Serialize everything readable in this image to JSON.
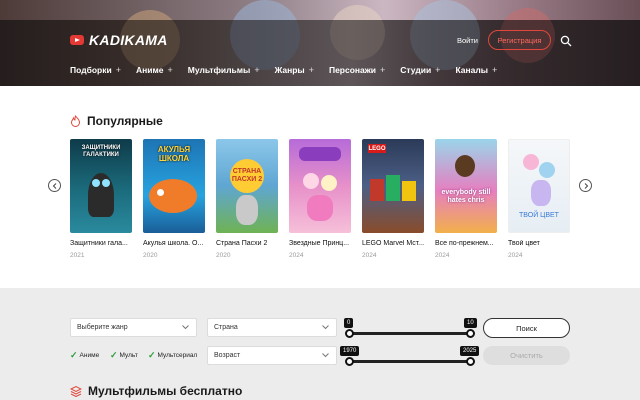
{
  "header": {
    "logo_text": "KADIKAMA",
    "login_label": "Войти",
    "register_label": "Регистрация",
    "nav": [
      {
        "label": "Подборки"
      },
      {
        "label": "Аниме"
      },
      {
        "label": "Мультфильмы"
      },
      {
        "label": "Жанры"
      },
      {
        "label": "Персонажи"
      },
      {
        "label": "Студии"
      },
      {
        "label": "Каналы"
      }
    ],
    "nav_plus": "+"
  },
  "popular": {
    "title": "Популярные",
    "cards": [
      {
        "title": "Защитники гала...",
        "year": "2021",
        "poster_text": "ЗАЩИТНИКИ ГАЛАКТИКИ",
        "bg": "#1b6c7d"
      },
      {
        "title": "Акулья школа. О...",
        "year": "2020",
        "poster_text": "АКУЛЬЯ ШКОЛА",
        "bg": "#1d8bc9"
      },
      {
        "title": "Страна Пасхи 2",
        "year": "2020",
        "poster_text": "СТРАНА ПАСХИ 2",
        "bg": "#6fb0d6"
      },
      {
        "title": "Звездные Принц...",
        "year": "2024",
        "poster_text": "",
        "bg": "#d37bc7"
      },
      {
        "title": "LEGO Marvel Мст...",
        "year": "2024",
        "poster_text": "LEGO",
        "bg": "#2f3d5e"
      },
      {
        "title": "Все по-прежнем...",
        "year": "2024",
        "poster_text": "everybody still hates chris",
        "bg": "#e57fc0"
      },
      {
        "title": "Твой цвет",
        "year": "2024",
        "poster_text": "ТВОЙ ЦВЕТ",
        "bg": "#eef3f6"
      }
    ]
  },
  "filters": {
    "genre_placeholder": "Выберите жанр",
    "country_placeholder": "Страна",
    "age_placeholder": "Возраст",
    "checkboxes": [
      "Аниме",
      "Мульт",
      "Мультсериал"
    ],
    "rating_min": "0",
    "rating_max": "10",
    "year_min": "1970",
    "year_max": "2025",
    "search_label": "Поиск",
    "clear_label": "Очистить"
  },
  "free_section": {
    "title": "Мультфильмы бесплатно"
  },
  "colors": {
    "accent": "#e0473a",
    "check": "#2e9e3e"
  }
}
